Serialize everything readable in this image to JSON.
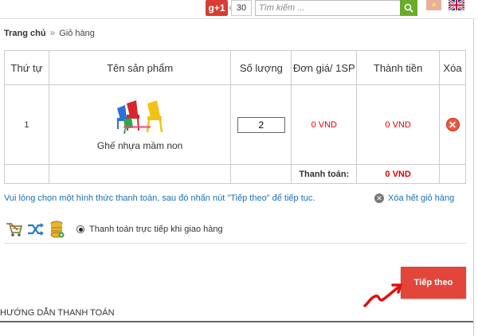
{
  "topbar": {
    "gplus_label": "g+1",
    "gplus_count": "30",
    "search_placeholder": "Tìm kiếm ..."
  },
  "breadcrumb": {
    "home": "Trang chủ",
    "separator": "»",
    "current": "Giỏ hàng"
  },
  "cart": {
    "headers": [
      "Thứ tự",
      "Tên sản phẩm",
      "Số lượng",
      "Đơn giá/ 1SP",
      "Thành tiền",
      "Xóa"
    ],
    "rows": [
      {
        "index": "1",
        "product_name": "Ghế nhựa mầm non",
        "quantity": "2",
        "unit_price": "0 VND",
        "line_total": "0 VND"
      }
    ],
    "total_label": "Thanh toán:",
    "total_value": "0 VND"
  },
  "notice": "Vui lòng chọn một hình thức thanh toán, sau đó nhấn nút \"Tiếp theo\" để tiếp tục.",
  "clear_all": "Xóa hết giỏ hàng",
  "payment": {
    "option_label": "Thanh toán trực tiếp khi giao hàng"
  },
  "next_button": "Tiếp theo",
  "guide_title": "HƯỚNG DẪN THANH TOÁN",
  "colors": {
    "accent_red": "#e2463b",
    "price_red": "#e10000",
    "link_blue": "#1a6fb4",
    "search_green": "#6aab2c"
  }
}
